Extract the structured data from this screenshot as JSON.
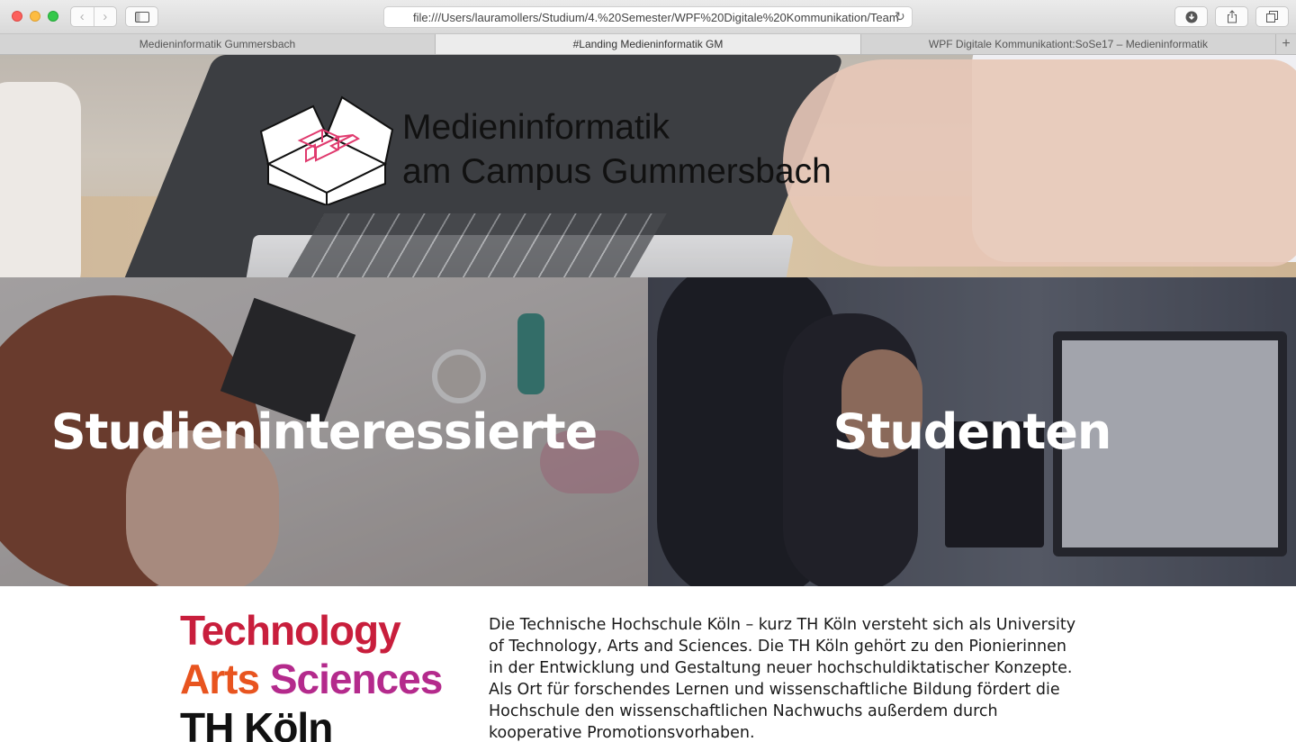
{
  "browser": {
    "url": "file:///Users/lauramollers/Studium/4.%20Semester/WPF%20Digitale%20Kommunikation/Team",
    "tabs": [
      {
        "label": "Medieninformatik Gummersbach",
        "active": false
      },
      {
        "label": "#Landing Medieninformatik GM",
        "active": true
      },
      {
        "label": "WPF Digitale Kommunikationt:SoSe17 – Medieninformatik",
        "active": false
      }
    ],
    "icons": {
      "back": "chevron-left-icon",
      "forward": "chevron-right-icon",
      "sidebar": "sidebar-icon",
      "reload": "reload-icon",
      "download": "download-icon",
      "share": "share-icon",
      "tabs": "tabs-overview-icon",
      "add_tab": "plus-icon"
    }
  },
  "hero": {
    "title_line1": "Medieninformatik",
    "title_line2": "am Campus Gummersbach"
  },
  "panels": {
    "left_label": "Studieninteressierte",
    "right_label": "Studenten"
  },
  "footer": {
    "logo_line1": "Technology",
    "logo_arts": "Arts",
    "logo_sciences": "Sciences",
    "logo_line3": "TH Köln",
    "intro": "Die Technische Hochschule Köln – kurz TH Köln versteht sich als University of Technology, Arts and Sciences. Die TH Köln gehört zu den Pionierinnen in der Entwicklung und Gestaltung neuer hochschuldiktatischer Konzepte. Als Ort für forschendes Lernen und wissenschaftliche Bildung fördert die Hochschule den wissenschaftlichen Nachwuchs außerdem durch kooperative Promotionsvorhaben."
  },
  "colors": {
    "technology": "#c81e3c",
    "arts": "#e8541f",
    "sciences": "#b42a8c",
    "logo_accent": "#e03a6e"
  }
}
